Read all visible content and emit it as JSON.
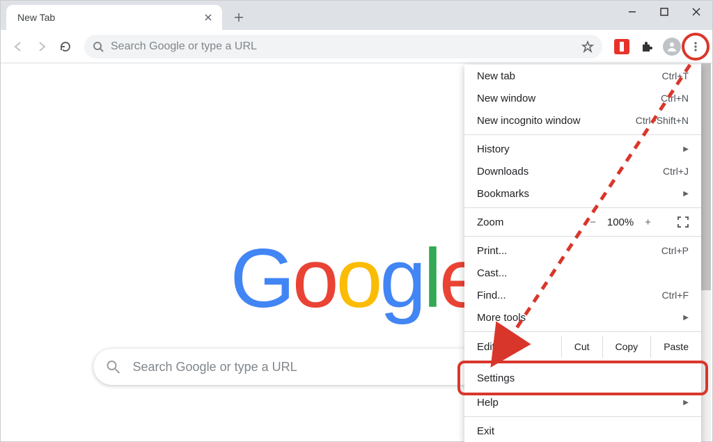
{
  "tab": {
    "title": "New Tab"
  },
  "omnibox": {
    "placeholder": "Search Google or type a URL"
  },
  "logo": [
    "G",
    "o",
    "o",
    "g",
    "l",
    "e"
  ],
  "searchbox": {
    "placeholder": "Search Google or type a URL"
  },
  "menu": {
    "new_tab": {
      "label": "New tab",
      "shortcut": "Ctrl+T"
    },
    "new_window": {
      "label": "New window",
      "shortcut": "Ctrl+N"
    },
    "new_incognito": {
      "label": "New incognito window",
      "shortcut": "Ctrl+Shift+N"
    },
    "history": {
      "label": "History"
    },
    "downloads": {
      "label": "Downloads",
      "shortcut": "Ctrl+J"
    },
    "bookmarks": {
      "label": "Bookmarks"
    },
    "zoom": {
      "label": "Zoom",
      "value": "100%"
    },
    "print": {
      "label": "Print...",
      "shortcut": "Ctrl+P"
    },
    "cast": {
      "label": "Cast..."
    },
    "find": {
      "label": "Find...",
      "shortcut": "Ctrl+F"
    },
    "more_tools": {
      "label": "More tools"
    },
    "edit": {
      "label": "Edit",
      "cut": "Cut",
      "copy": "Copy",
      "paste": "Paste"
    },
    "settings": {
      "label": "Settings"
    },
    "help": {
      "label": "Help"
    },
    "exit": {
      "label": "Exit"
    }
  }
}
